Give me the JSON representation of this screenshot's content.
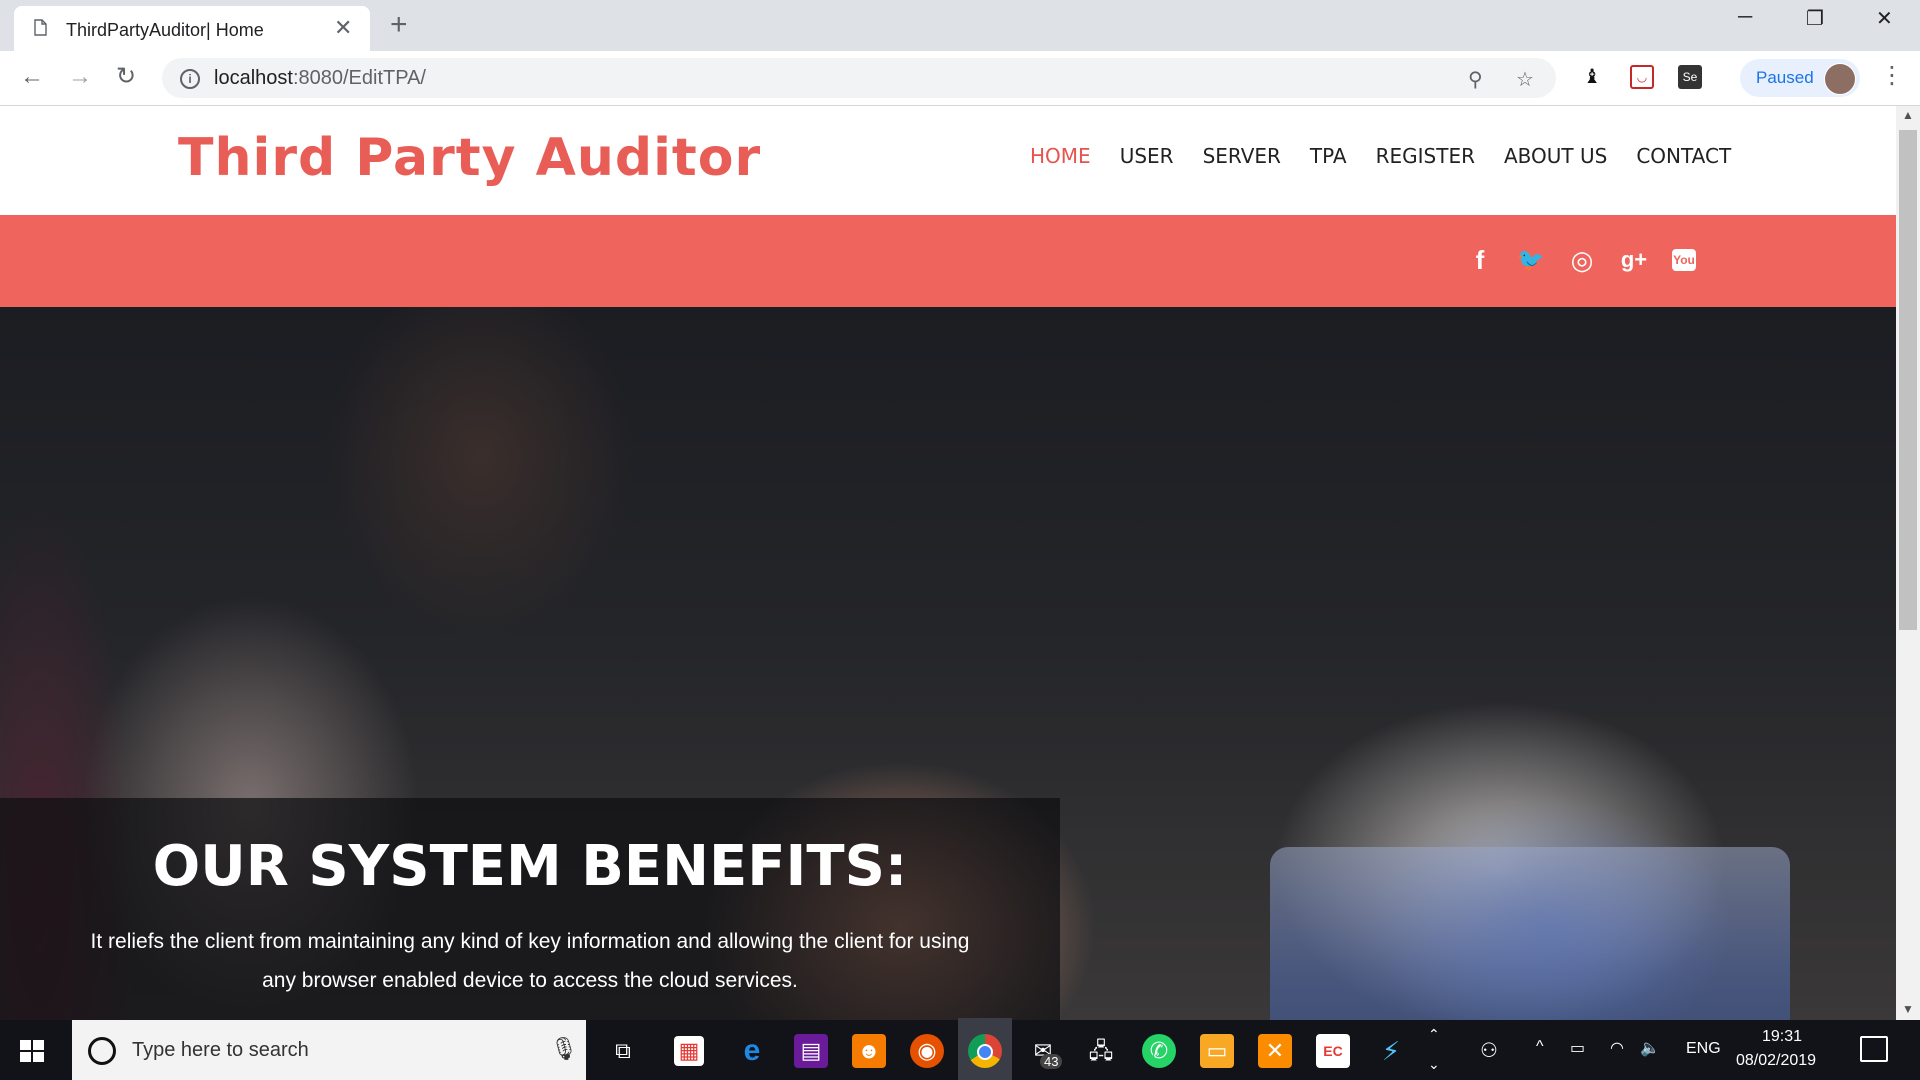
{
  "browser": {
    "tab_title": "ThirdPartyAuditor| Home",
    "tab_close": "✕",
    "new_tab": "+",
    "url_host": "localhost",
    "url_path": ":8080/EditTPA/",
    "profile_status": "Paused",
    "window_controls": [
      "─",
      "❐",
      "✕"
    ]
  },
  "site": {
    "logo": "Third Party Auditor",
    "nav": [
      "HOME",
      "USER",
      "SERVER",
      "TPA",
      "REGISTER",
      "ABOUT US",
      "CONTACT"
    ],
    "active_nav": "HOME",
    "social_icons": [
      "facebook-icon",
      "twitter-icon",
      "dribbble-icon",
      "google-plus-icon",
      "youtube-icon"
    ],
    "social_glyphs": {
      "facebook": "f",
      "twitter": "🐦",
      "dribbble": "◎",
      "google_plus": "g+",
      "youtube": "You"
    }
  },
  "hero": {
    "title": "OUR SYSTEM BENEFITS:",
    "text": "It reliefs the client from maintaining any kind of key information and allowing the client for using any browser enabled device to access the cloud services."
  },
  "taskbar": {
    "search_placeholder": "Type here to search",
    "mail_badge": "43",
    "language": "ENG",
    "time": "19:31",
    "date": "08/02/2019"
  },
  "colors": {
    "accent": "#ef645c",
    "logo": "#e85d56",
    "nav_active": "#e8534d"
  }
}
